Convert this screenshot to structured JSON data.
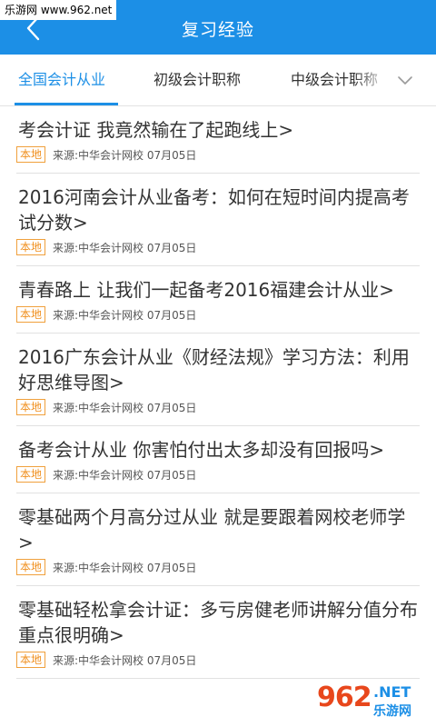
{
  "watermark": {
    "top_text": "乐游网 www.962.net",
    "bottom_num": "962",
    "bottom_net": ".NET",
    "bottom_cn": "乐游网"
  },
  "header": {
    "title": "复习经验",
    "back_icon": "chevron-left-icon",
    "bg_color": "#1c8fe6"
  },
  "tabs": [
    {
      "label": "全国会计从业",
      "active": true
    },
    {
      "label": "初级会计职称",
      "active": false
    },
    {
      "label": "中级会计职称",
      "active": false
    }
  ],
  "tabs_dropdown_icon": "chevron-down-icon",
  "articles": [
    {
      "title": "考会计证 我竟然输在了起跑线上>",
      "tag": "本地",
      "source": "来源:中华会计网校 07月05日"
    },
    {
      "title": "2016河南会计从业备考：如何在短时间内提高考试分数>",
      "tag": "本地",
      "source": "来源:中华会计网校 07月05日"
    },
    {
      "title": "青春路上 让我们一起备考2016福建会计从业>",
      "tag": "本地",
      "source": "来源:中华会计网校 07月05日"
    },
    {
      "title": "2016广东会计从业《财经法规》学习方法：利用好思维导图>",
      "tag": "本地",
      "source": "来源:中华会计网校 07月05日"
    },
    {
      "title": "备考会计从业 你害怕付出太多却没有回报吗>",
      "tag": "本地",
      "source": "来源:中华会计网校 07月05日"
    },
    {
      "title": "零基础两个月高分过从业 就是要跟着网校老师学>",
      "tag": "本地",
      "source": "来源:中华会计网校 07月05日"
    },
    {
      "title": "零基础轻松拿会计证：多亏房健老师讲解分值分布 重点很明确>",
      "tag": "本地",
      "source": "来源:中华会计网校 07月05日"
    }
  ]
}
